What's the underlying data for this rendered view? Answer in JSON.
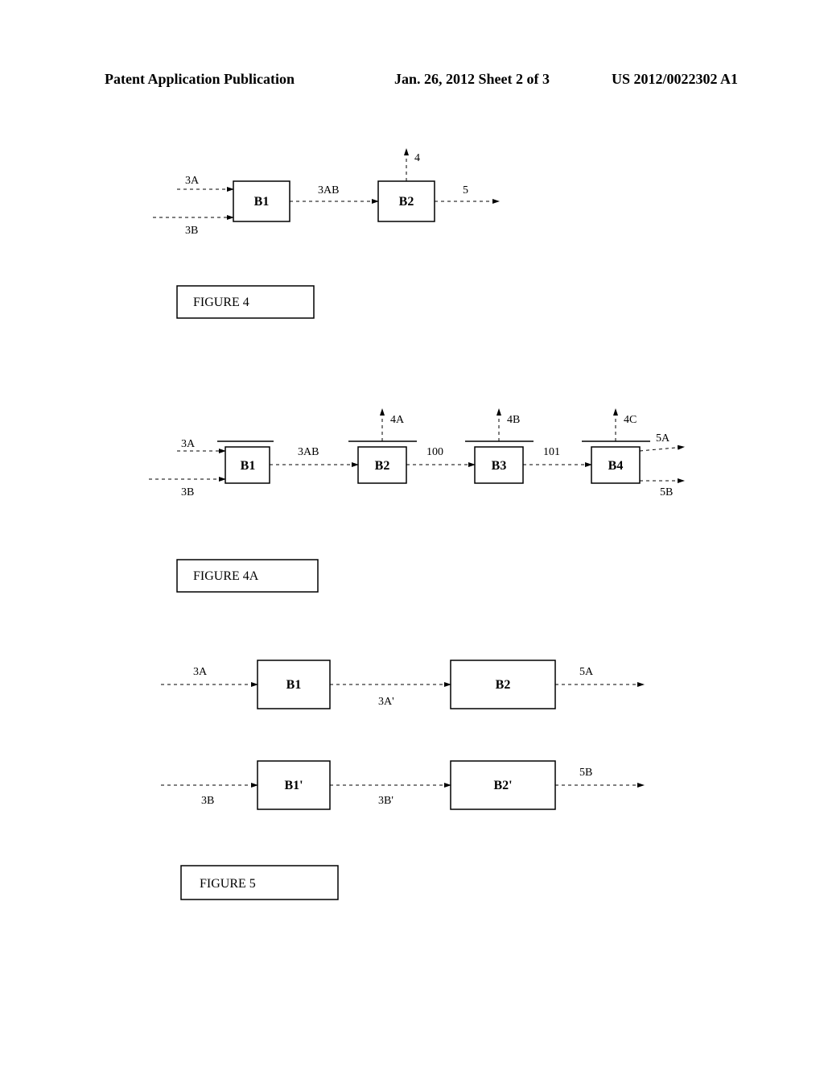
{
  "header": {
    "left": "Patent Application Publication",
    "mid": "Jan. 26, 2012  Sheet 2 of 3",
    "right": "US 2012/0022302 A1"
  },
  "fig4": {
    "caption": "FIGURE 4",
    "B1": "B1",
    "B2": "B2",
    "e3A": "3A",
    "e3B": "3B",
    "e3AB": "3AB",
    "e4": "4",
    "e5": "5"
  },
  "fig4A": {
    "caption": "FIGURE 4A",
    "B1": "B1",
    "B2": "B2",
    "B3": "B3",
    "B4": "B4",
    "e3A": "3A",
    "e3B": "3B",
    "e3AB": "3AB",
    "e4A": "4A",
    "e4B": "4B",
    "e4C": "4C",
    "e100": "100",
    "e101": "101",
    "e5A": "5A",
    "e5B": "5B"
  },
  "fig5": {
    "caption": "FIGURE 5",
    "B1": "B1",
    "B2": "B2",
    "B1p": "B1'",
    "B2p": "B2'",
    "e3A": "3A",
    "e3Ap": "3A'",
    "e5A": "5A",
    "e3B": "3B",
    "e3Bp": "3B'",
    "e5B": "5B"
  }
}
